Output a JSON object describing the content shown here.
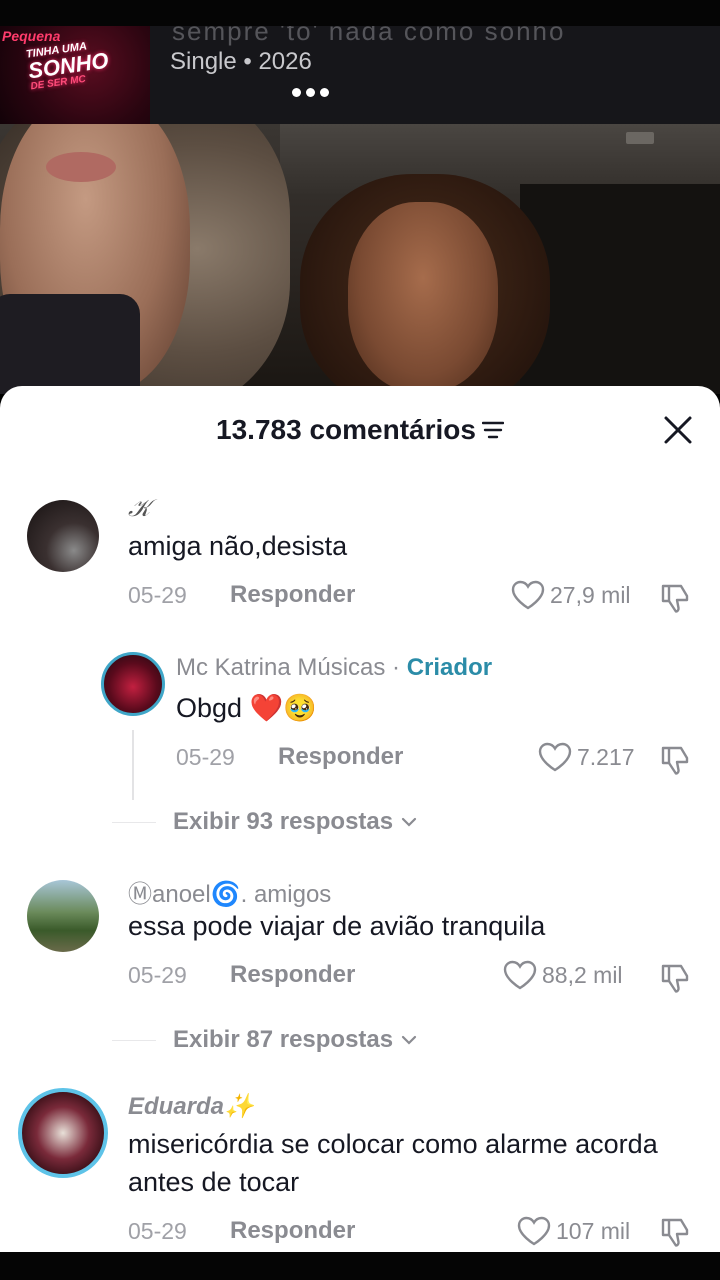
{
  "music": {
    "title_partial": "sempre 'to' nada como sonho",
    "meta": "Single • 2026",
    "cover_text": [
      "Pequena",
      "TINHA UMA",
      "SONHO",
      "DE SER MC"
    ]
  },
  "comments_sheet": {
    "count_label": "13.783 comentários",
    "reply_label": "Responder",
    "comments": [
      {
        "username": "𝒦",
        "text": "amiga não,desista",
        "date": "05-29",
        "likes": "27,9 mil",
        "replies_label": "Exibir 93 respostas",
        "reply": {
          "username": "Mc Katrina Músicas",
          "separator": " · ",
          "badge": "Criador",
          "text": "Obgd ❤️🥹",
          "date": "05-29",
          "likes": "7.217"
        }
      },
      {
        "username": "Ⓜanoel🌀. amigos",
        "text": "essa pode viajar de avião tranquila",
        "date": "05-29",
        "likes": "88,2 mil",
        "replies_label": "Exibir 87 respostas"
      },
      {
        "username": "Eduarda✨",
        "text": "misericórdia se colocar como alarme acorda antes de tocar",
        "date": "05-29",
        "likes": "107 mil"
      }
    ]
  },
  "colors": {
    "creator_badge": "#2b8ca8",
    "primary_text": "#161823",
    "secondary_text": "#8a8b91"
  }
}
